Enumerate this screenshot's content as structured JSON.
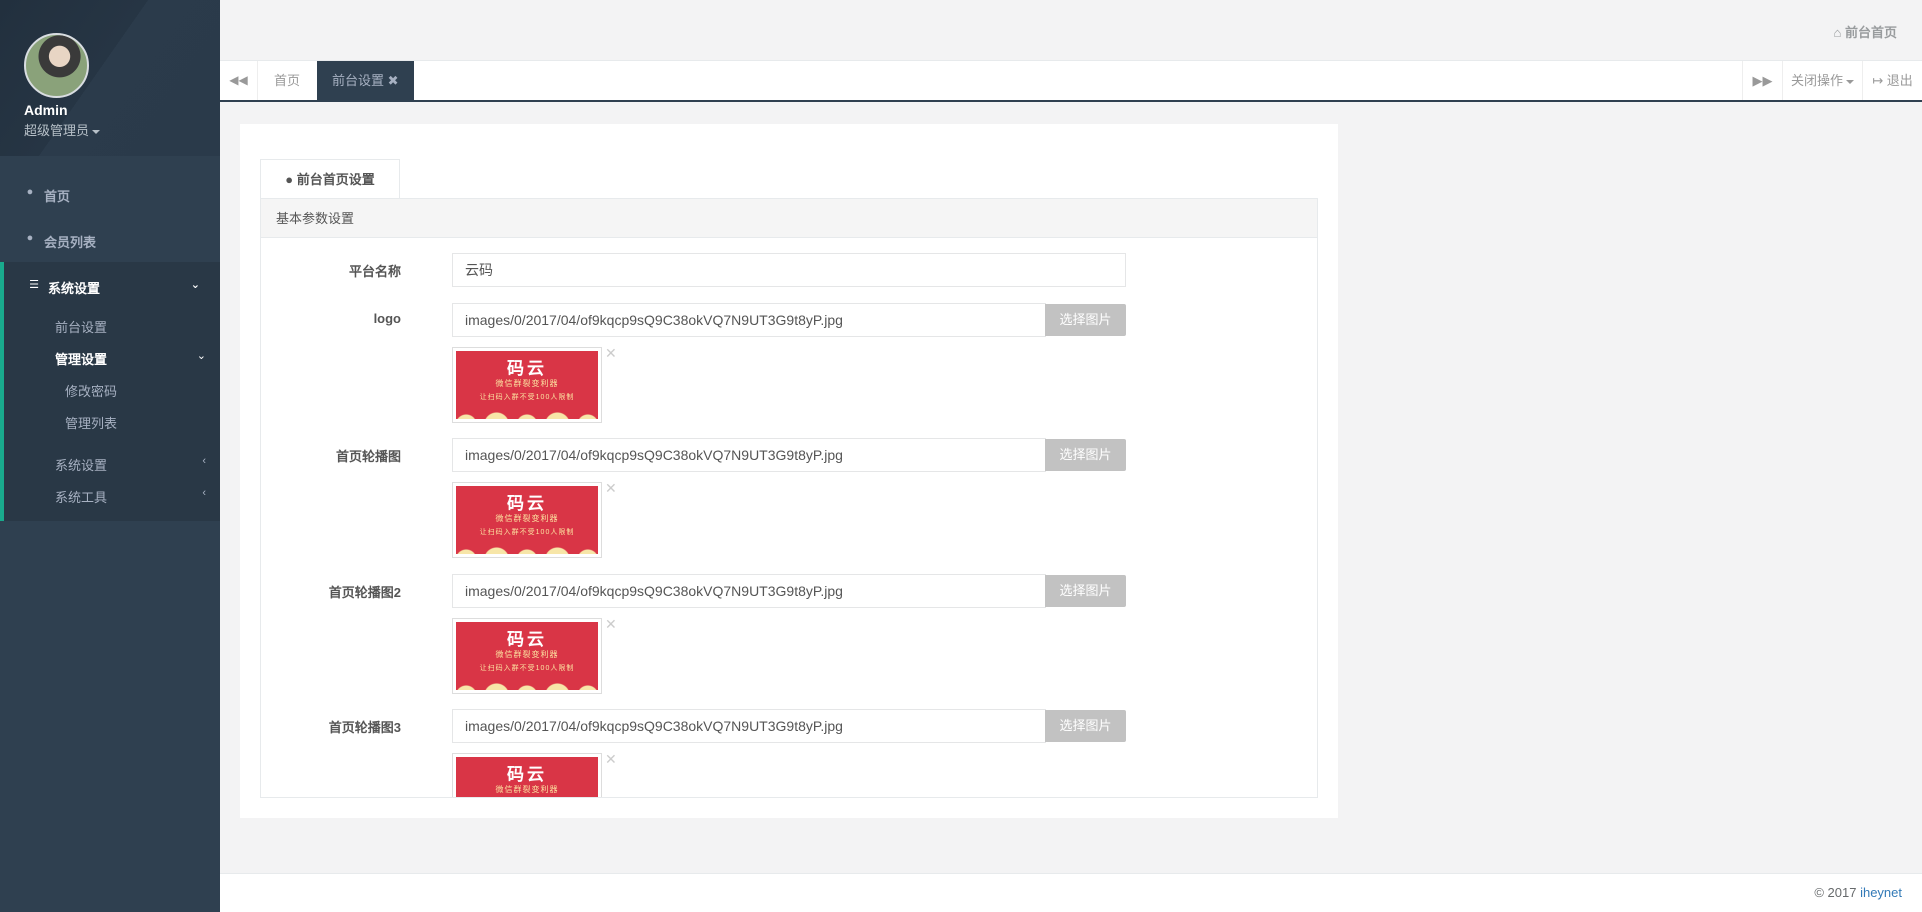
{
  "profile": {
    "name": "Admin",
    "role": "超级管理员"
  },
  "sidebar": {
    "items": [
      {
        "label": "首页",
        "icon": "user-icon"
      },
      {
        "label": "会员列表",
        "icon": "user-icon"
      },
      {
        "label": "系统设置",
        "icon": "cutlery-icon"
      }
    ],
    "sub": {
      "front_settings": "前台设置",
      "admin_settings": "管理设置",
      "change_password": "修改密码",
      "admin_list": "管理列表",
      "system_settings": "系统设置",
      "system_tools": "系统工具"
    }
  },
  "topbar": {
    "home_link": "前台首页"
  },
  "tabs": {
    "home": "首页",
    "front_settings": "前台设置",
    "close_ops": "关闭操作",
    "logout": "退出"
  },
  "panel": {
    "tab_label": "前台首页设置",
    "section_title": "基本参数设置",
    "platform_label": "平台名称",
    "platform_value": "云码",
    "pick_label": "选择图片",
    "image_rows": [
      {
        "label": "logo",
        "value": "images/0/2017/04/of9kqcp9sQ9C38okVQ7N9UT3G9t8yP.jpg"
      },
      {
        "label": "首页轮播图",
        "value": "images/0/2017/04/of9kqcp9sQ9C38okVQ7N9UT3G9t8yP.jpg"
      },
      {
        "label": "首页轮播图2",
        "value": "images/0/2017/04/of9kqcp9sQ9C38okVQ7N9UT3G9t8yP.jpg"
      },
      {
        "label": "首页轮播图3",
        "value": "images/0/2017/04/of9kqcp9sQ9C38okVQ7N9UT3G9t8yP.jpg"
      }
    ],
    "thumb": {
      "title": "码云",
      "line1": "微信群裂变利器",
      "line2": "让扫码入群不受100人限制"
    }
  },
  "footer": {
    "copyright": "© 2017 ",
    "brand": "iheynet"
  },
  "colors": {
    "sidebar": "#2f4050",
    "accent": "#19aa8d",
    "thumb_red": "#d93546"
  }
}
